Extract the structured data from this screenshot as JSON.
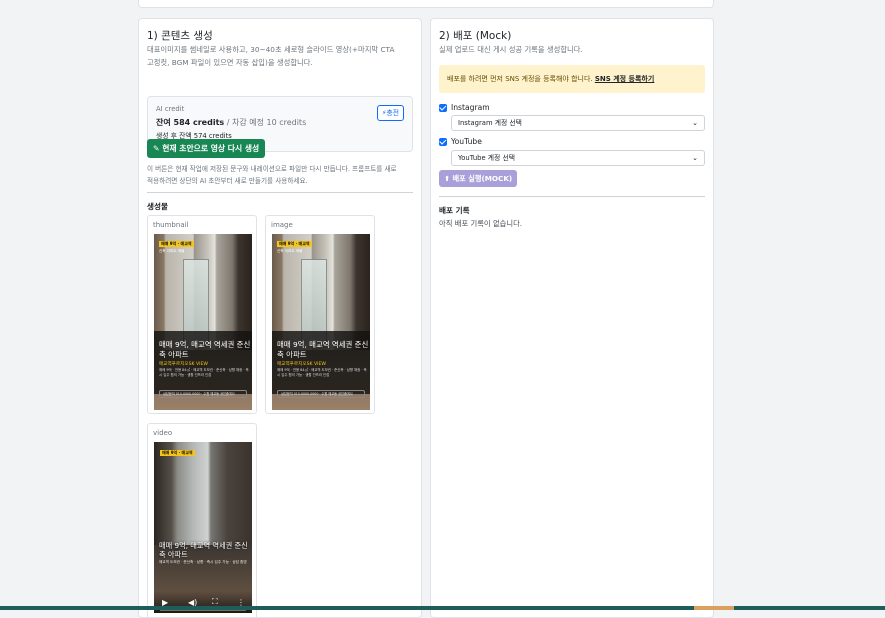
{
  "left": {
    "title": "1) 콘텐츠 생성",
    "desc_line1": "대표이미지를 썸네일로 사용하고, 30~40초 세로형 슬라이드 영상(+마지막 CTA",
    "desc_line2": "고정컷, BGM 파일이 있으면 자동 삽입)을 생성합니다.",
    "credit": {
      "label": "AI credit",
      "remaining": "잔여 584 credits",
      "expected": " / 차감 예정 10 credits",
      "after": "생성 후 잔액 574 credits",
      "charge_button": "⚡충전"
    },
    "regen_button": "✎ 현재 초안으로 영상 다시 생성",
    "note_line1": "이 버튼은 현재 작업에 저장된 문구와 내레이션으로 파일만 다시 만듭니다. 프롬프트를 새로",
    "note_line2": "적용하려면 상단의 AI 초안부터 새로 만들기를 사용하세요.",
    "outputs_title": "생성물",
    "assets": [
      {
        "label": "thumbnail"
      },
      {
        "label": "image"
      },
      {
        "label": "video"
      }
    ],
    "thumb": {
      "badge": "매매 9억 · 매교역",
      "badge_sub": "신축 아파트 매물",
      "headline": "매매 9억, 매교역 역세권 준신축 아파트",
      "tag": "매교역푸르지오SK VIEW",
      "meta": "매매 9억 · 전용 84㎡ · 매교역 도보권 · 준신축 · 남향 채광 · 즉시 입주 협의 가능 · 생활 인프라 인접",
      "bar": "상담문의 010-0000-0000 · 수원 매교동 공인중개사"
    },
    "video": {
      "headline": "매매 9억, 매교역 역세권 준신축 아파트",
      "meta": "매교역 도보권 · 준신축 · 남향 · 즉시 입주 가능 · 상담 환영",
      "progress": 0.0
    }
  },
  "right": {
    "title": "2) 배포 (Mock)",
    "desc": "실제 업로드 대신 게시 성공 기록을 생성합니다.",
    "warning_text": "배포를 하려면 먼저 SNS 계정을 등록해야 합니다. ",
    "warning_link": "SNS 계정 등록하기",
    "instagram_label": "Instagram",
    "instagram_select": "Instagram 계정 선택",
    "youtube_label": "YouTube",
    "youtube_select": "YouTube 계정 선택",
    "deploy_button": "배포 실행(MOCK)",
    "history_title": "배포 기록",
    "history_empty": "아직 배포 기록이 없습니다."
  },
  "colors": {
    "accent": "#0d6efd",
    "success": "#198754",
    "warning_bg": "#fff3cd",
    "deploy_disabled": "#a9a0d9"
  }
}
